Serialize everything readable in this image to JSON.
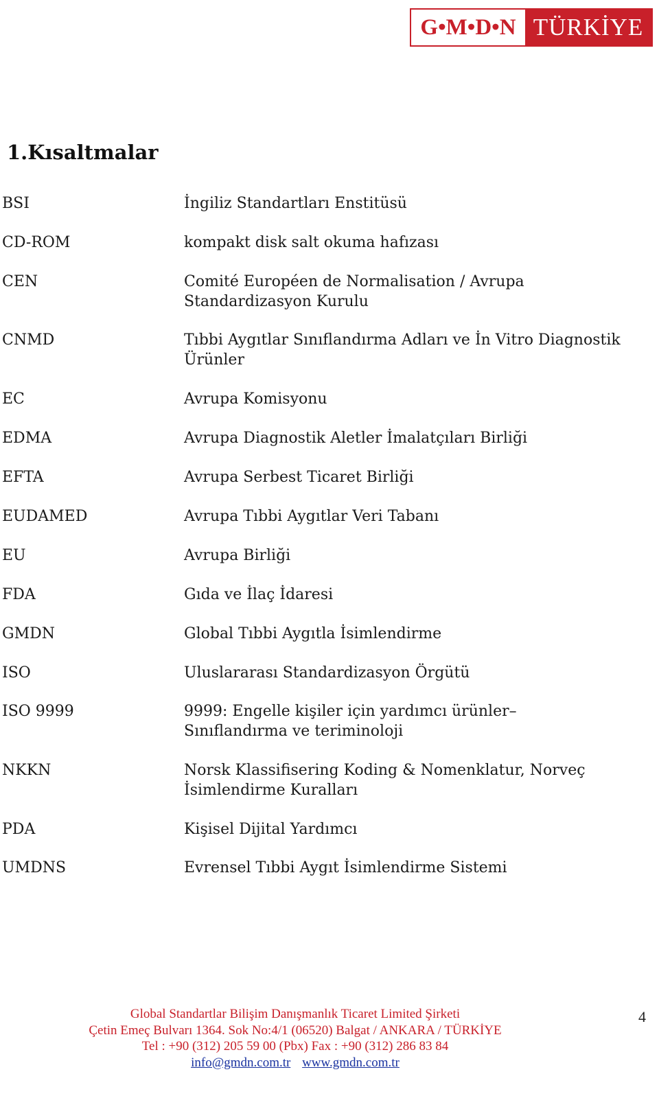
{
  "logo": {
    "left_text": "G•M•D•N",
    "right_text": "TÜRKİYE",
    "brand_color": "#c8202a"
  },
  "heading": "1.Kısaltmalar",
  "abbreviations": [
    {
      "abbr": "BSI",
      "definition": "İngiliz Standartları Enstitüsü"
    },
    {
      "abbr": "CD-ROM",
      "definition": "kompakt disk salt okuma hafızası"
    },
    {
      "abbr": "CEN",
      "definition": "Comité Européen de Normalisation / Avrupa Standardizasyon Kurulu"
    },
    {
      "abbr": "CNMD",
      "definition": "Tıbbi Aygıtlar Sınıflandırma Adları ve İn Vitro Diagnostik Ürünler"
    },
    {
      "abbr": "EC",
      "definition": "Avrupa Komisyonu"
    },
    {
      "abbr": "EDMA",
      "definition": "Avrupa Diagnostik Aletler İmalatçıları Birliği"
    },
    {
      "abbr": "EFTA",
      "definition": "Avrupa Serbest Ticaret Birliği"
    },
    {
      "abbr": "EUDAMED",
      "definition": "Avrupa Tıbbi Aygıtlar Veri Tabanı"
    },
    {
      "abbr": "EU",
      "definition": "Avrupa Birliği"
    },
    {
      "abbr": "FDA",
      "definition": "Gıda ve İlaç İdaresi"
    },
    {
      "abbr": "GMDN",
      "definition": "Global Tıbbi Aygıtla İsimlendirme"
    },
    {
      "abbr": "ISO",
      "definition": "Uluslararası Standardizasyon Örgütü"
    },
    {
      "abbr": "ISO 9999",
      "definition": "9999: Engelle kişiler için yardımcı ürünler– Sınıflandırma ve teriminoloji"
    },
    {
      "abbr": "NKKN",
      "definition": "Norsk Klassifisering Koding & Nomenklatur, Norveç İsimlendirme Kuralları"
    },
    {
      "abbr": "PDA",
      "definition": "Kişisel Dijital Yardımcı"
    },
    {
      "abbr": "UMDNS",
      "definition": "Evrensel Tıbbi Aygıt İsimlendirme Sistemi"
    }
  ],
  "footer": {
    "company": "Global Standartlar Bilişim Danışmanlık Ticaret Limited Şirketi",
    "address": "Çetin Emeç Bulvarı 1364. Sok No:4/1  (06520)   Balgat / ANKARA / TÜRKİYE",
    "phone": "Tel : +90 (312) 205 59 00 (Pbx)    Fax : +90 (312) 286 83 84",
    "email": "info@gmdn.com.tr",
    "website": "www.gmdn.com.tr"
  },
  "page_number": "4"
}
